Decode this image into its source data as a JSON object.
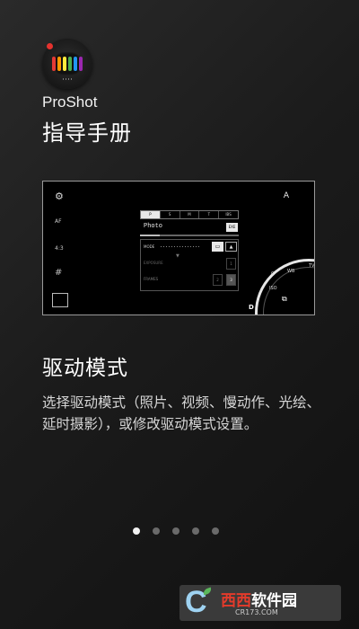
{
  "app": {
    "name": "ProShot",
    "guide_title": "指导手册",
    "icon_colors": [
      "#e53935",
      "#ff9800",
      "#ffeb3b",
      "#4caf50",
      "#2196f3",
      "#9c27b0"
    ]
  },
  "preview": {
    "left_controls": {
      "af": "AF",
      "ratio": "4:3"
    },
    "top_right": "A",
    "mode_tabs": [
      "P",
      "S",
      "M",
      "T",
      "IBS"
    ],
    "selected_mode_index": 0,
    "photo_label": "Photo",
    "exec_label": "EXE",
    "rows": {
      "mode": "MODE",
      "exposure": "EXPOSURE",
      "frames": "FRAMES"
    },
    "frames_values": [
      "2",
      "3"
    ],
    "exposure_value": "1",
    "dial": {
      "labels": [
        "ISO",
        "WB",
        "TV",
        "EV",
        "C"
      ],
      "current": "D"
    }
  },
  "section": {
    "title": "驱动模式",
    "description": "选择驱动模式（照片、视频、慢动作、光绘、延时摄影），或修改驱动模式设置。"
  },
  "pager": {
    "count": 5,
    "active_index": 0
  },
  "watermark": {
    "brand_a": "西西",
    "brand_b": "软件园",
    "url": "CR173.COM"
  }
}
